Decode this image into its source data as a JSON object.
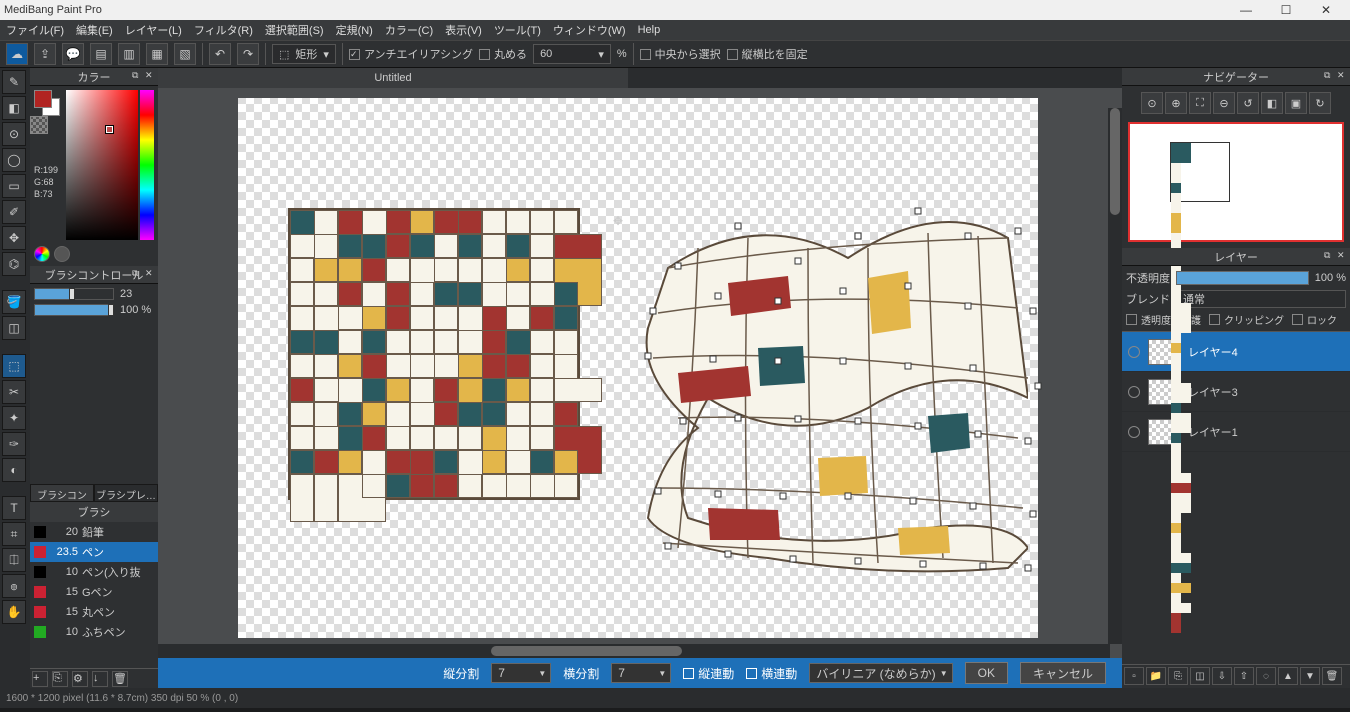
{
  "app_title": "MediBang Paint Pro",
  "window_buttons": {
    "min": "—",
    "max": "☐",
    "close": "✕"
  },
  "menu": [
    "ファイル(F)",
    "編集(E)",
    "レイヤー(L)",
    "フィルタ(R)",
    "選択範囲(S)",
    "定規(N)",
    "カラー(C)",
    "表示(V)",
    "ツール(T)",
    "ウィンドウ(W)",
    "Help"
  ],
  "toolbar": {
    "shape_sel": "矩形",
    "antialias_label": "アンチエイリアシング",
    "round_label": "丸める",
    "round_value": "60",
    "pct_label": "%",
    "center_label": "中央から選択",
    "aspect_label": "縦横比を固定"
  },
  "color_panel": {
    "title": "カラー",
    "rgb": "R:199\nG:68\nB:73"
  },
  "brush_ctrl": {
    "title": "ブラシコントロール",
    "size_value": "23",
    "opacity_value": "100 %"
  },
  "brush_tabs": [
    "ブラシコント…",
    "ブラシプレ…"
  ],
  "brush_label": "ブラシ",
  "brushes": [
    {
      "size": "20",
      "name": "鉛筆",
      "color": "#000",
      "sel": false
    },
    {
      "size": "23.5",
      "name": "ペン",
      "color": "#c23",
      "sel": true
    },
    {
      "size": "10",
      "name": "ペン(入り抜",
      "color": "#000",
      "sel": false
    },
    {
      "size": "15",
      "name": "Gペン",
      "color": "#c23",
      "sel": false
    },
    {
      "size": "15",
      "name": "丸ペン",
      "color": "#c23",
      "sel": false
    },
    {
      "size": "10",
      "name": "ふちペン",
      "color": "#2a2",
      "sel": false
    }
  ],
  "doc_tab": "Untitled",
  "mesh_options": {
    "vdiv_label": "縦分割",
    "vdiv_value": "7",
    "hdiv_label": "横分割",
    "hdiv_value": "7",
    "vlink_label": "縦連動",
    "hlink_label": "横連動",
    "interp_value": "バイリニア (なめらか)",
    "ok": "OK",
    "cancel": "キャンセル"
  },
  "nav_title": "ナビゲーター",
  "layer_panel": {
    "title": "レイヤー",
    "opacity_label": "不透明度",
    "opacity_value": "100 %",
    "blend_label": "ブレンド",
    "blend_value": "通常",
    "chk_alpha": "透明度を保護",
    "chk_clip": "クリッピング",
    "chk_lock": "ロック"
  },
  "layers": [
    {
      "name": "レイヤー4",
      "sel": true
    },
    {
      "name": "レイヤー3",
      "sel": false
    },
    {
      "name": "レイヤー1",
      "sel": false
    }
  ],
  "statusbar": "1600 * 1200 pixel  (11.6 * 8.7cm)  350 dpi  50 %  (0 , 0)"
}
